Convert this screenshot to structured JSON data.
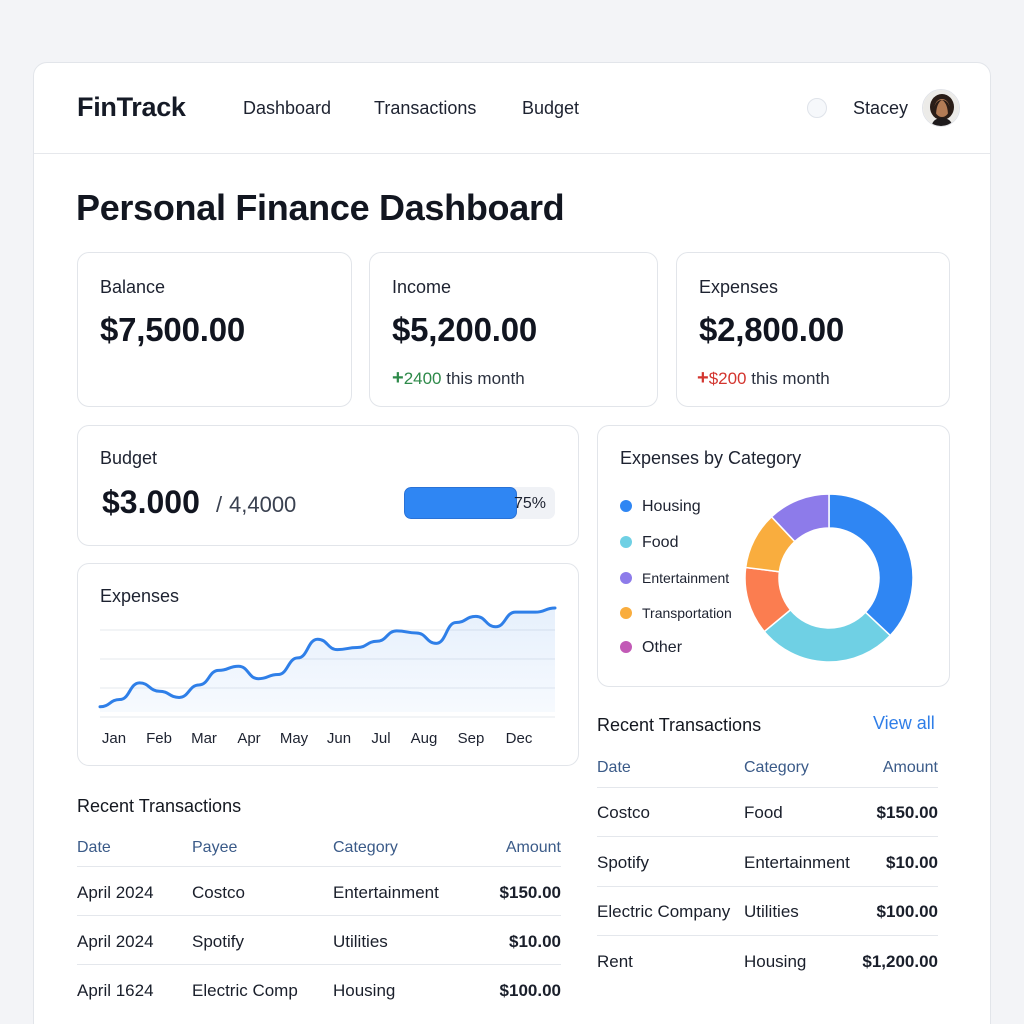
{
  "app": {
    "name": "FinTrack"
  },
  "nav": [
    {
      "label": "Dashboard"
    },
    {
      "label": "Transactions"
    },
    {
      "label": "Budget"
    }
  ],
  "user": {
    "name": "Stacey"
  },
  "page": {
    "title": "Personal Finance Dashboard"
  },
  "stats": {
    "balance": {
      "label": "Balance",
      "value": "$7,500.00"
    },
    "income": {
      "label": "Income",
      "value": "$5,200.00",
      "delta_sign": "+",
      "delta_value": "2400",
      "delta_suffix": " this month"
    },
    "expenses": {
      "label": "Expenses",
      "value": "$2,800.00",
      "delta_sign": "+",
      "delta_value": "$200",
      "delta_suffix": " this month"
    }
  },
  "budget": {
    "label": "Budget",
    "amount": "$3.000",
    "slash": "/",
    "total": "4,4000",
    "percent_label": "75%",
    "percent": 0.75
  },
  "expenses_chart": {
    "title": "Expenses"
  },
  "category": {
    "title": "Expenses by Category",
    "items": [
      {
        "label": "Housing",
        "color": "#2f86f3"
      },
      {
        "label": "Food",
        "color": "#6fd0e4"
      },
      {
        "label": "Entertainment",
        "color": "#8d7bea"
      },
      {
        "label": "Transportation",
        "color": "#f9ad3e"
      },
      {
        "label": "Other",
        "color": "#c25ab6"
      }
    ]
  },
  "chart_data": [
    {
      "type": "area",
      "title": "Expenses",
      "categories": [
        "Jan",
        "Feb",
        "Mar",
        "Apr",
        "May",
        "Jun",
        "Jul",
        "Aug",
        "Sep",
        "Dec"
      ],
      "series": [
        {
          "values": [
            0.05,
            0.12,
            0.28,
            0.2,
            0.14,
            0.26,
            0.4,
            0.44,
            0.32,
            0.36,
            0.52,
            0.7,
            0.6,
            0.62,
            0.68,
            0.78,
            0.76,
            0.66,
            0.86,
            0.92,
            0.82,
            0.96,
            0.96,
            1.0
          ]
        }
      ],
      "ylim": [
        0,
        1
      ],
      "grid": true,
      "color": "#2f7fe8"
    },
    {
      "type": "pie",
      "title": "Expenses by Category",
      "categories": [
        "Housing",
        "Food",
        "Entertainment",
        "Transportation",
        "Other"
      ],
      "values": [
        37,
        27,
        0,
        11,
        12
      ],
      "donut": true,
      "slices": [
        {
          "label": "Housing",
          "value": 37,
          "color": "#2f86f3"
        },
        {
          "label": "Food",
          "value": 27,
          "color": "#6fd0e4"
        },
        {
          "label": "Transportation",
          "value": 13,
          "color": "#fb7d50"
        },
        {
          "label": "Transportation",
          "value": 11,
          "color": "#f9ad3e"
        },
        {
          "label": "Entertainment",
          "value": 12,
          "color": "#8d7bea"
        }
      ]
    }
  ],
  "recent_left": {
    "title": "Recent Transactions",
    "headers": [
      "Date",
      "Payee",
      "Category",
      "Amount"
    ],
    "rows": [
      [
        "April 2024",
        "Costco",
        "Entertainment",
        "$150.00"
      ],
      [
        "April 2024",
        "Spotify",
        "Utilities",
        "$10.00"
      ],
      [
        "April 1624",
        "Electric Comp",
        "Housing",
        "$100.00"
      ]
    ]
  },
  "recent_right": {
    "title": "Recent Transactions",
    "view_all": "View all",
    "headers": [
      "Date",
      "Category",
      "Amount"
    ],
    "rows": [
      [
        "Costco",
        "Food",
        "$150.00"
      ],
      [
        "Spotify",
        "Entertainment",
        "$10.00"
      ],
      [
        "Electric Company",
        "Utilities",
        "$100.00"
      ],
      [
        "Rent",
        "Housing",
        "$1,200.00"
      ]
    ]
  }
}
